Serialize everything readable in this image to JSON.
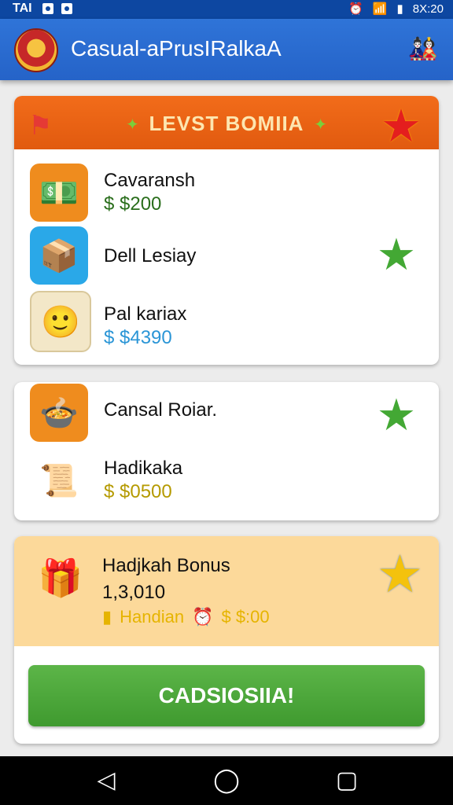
{
  "status_bar": {
    "carrier": "TAI",
    "time": "8X:20"
  },
  "app_bar": {
    "title": "Casual-aPrusIRalkaA",
    "logo_icon": "badge-icon",
    "profile_icon": "character-icon"
  },
  "level_bonus": {
    "banner_title": "LEVST BOMIIA",
    "items": [
      {
        "name": "Cavaransh",
        "price": "$ $200",
        "price_color": "#2a6e1c",
        "icon": "cash-bundle-icon",
        "icon_bg": "#ef8c1e",
        "starred": false
      },
      {
        "name": "Dell Lesiay",
        "price": "",
        "price_color": "#111111",
        "icon": "box-icon",
        "icon_bg": "#2aa8e8",
        "starred": true
      },
      {
        "name": "Pal kariax",
        "price": "$ $4390",
        "price_color": "#2a95d6",
        "icon": "smiley-icon",
        "icon_bg": "#f3e7c8",
        "starred": false
      }
    ]
  },
  "second_list": {
    "items": [
      {
        "name": "Cansal Roiar.",
        "price": "",
        "price_color": "#111111",
        "icon": "cauldron-icon",
        "icon_bg": "#ef8c1e",
        "starred": true
      },
      {
        "name": "Hadikaka",
        "price": "$ $0500",
        "price_color": "#b59a00",
        "icon": "scroll-icon",
        "icon_bg": "#ffffff",
        "starred": false
      }
    ]
  },
  "bonus": {
    "title": "Hadjkah Bonus",
    "value": "1,3,010",
    "sub_label": "Handian",
    "sub_value": "$ $:00",
    "cta_label": "CADSIOSIIA!",
    "accent": "#fcd99a",
    "cta_color": "#4caf3c"
  },
  "nav": {
    "back": "◁",
    "home": "◯",
    "recent": "▢"
  }
}
